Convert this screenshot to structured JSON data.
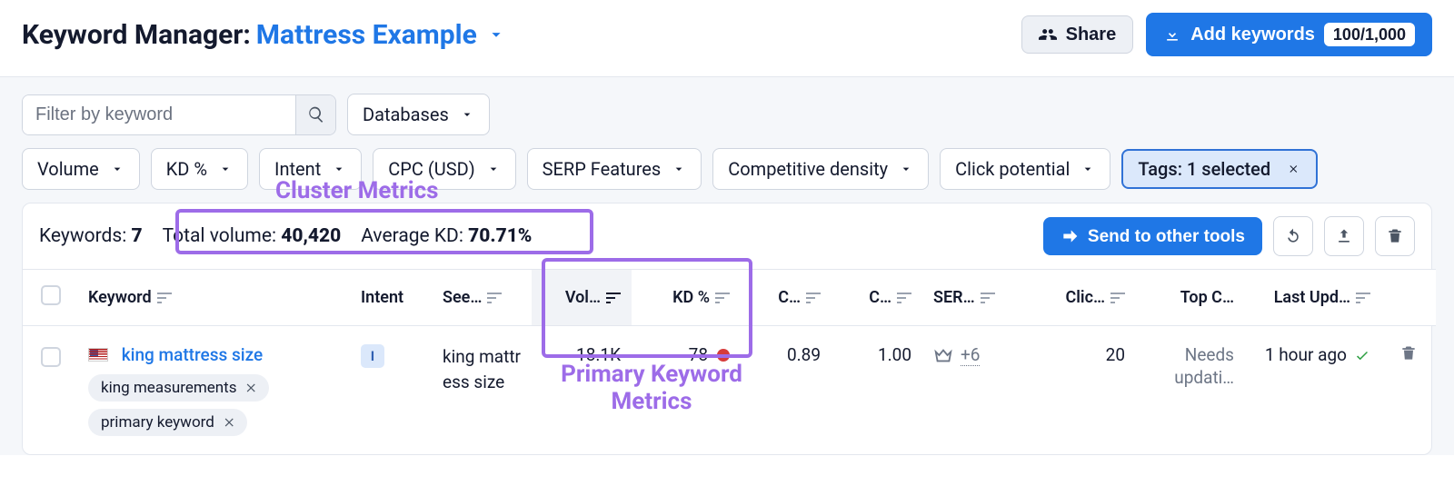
{
  "header": {
    "title_prefix": "Keyword Manager:",
    "project_name": "Mattress Example",
    "share_label": "Share",
    "add_label": "Add keywords",
    "add_count": "100/1,000"
  },
  "filters": {
    "search_placeholder": "Filter by keyword",
    "databases_label": "Databases",
    "items": [
      {
        "label": "Volume"
      },
      {
        "label": "KD %"
      },
      {
        "label": "Intent"
      },
      {
        "label": "CPC (USD)"
      },
      {
        "label": "SERP Features"
      },
      {
        "label": "Competitive density"
      },
      {
        "label": "Click potential"
      }
    ],
    "tags_label": "Tags: 1 selected"
  },
  "summary": {
    "keywords_label": "Keywords:",
    "keywords_value": "7",
    "total_volume_label": "Total volume:",
    "total_volume_value": "40,420",
    "avg_kd_label": "Average KD:",
    "avg_kd_value": "70.71%",
    "send_label": "Send to other tools"
  },
  "columns": {
    "keyword": "Keyword",
    "intent": "Intent",
    "seed": "See…",
    "vol": "Vol…",
    "kd": "KD %",
    "cpc": "C…",
    "cd": "C…",
    "serp": "SER…",
    "click": "Clic…",
    "topc": "Top C…",
    "lu": "Last Upd…"
  },
  "rows": [
    {
      "keyword": "king mattress size",
      "tags": [
        "king measurements",
        "primary keyword"
      ],
      "intent": "I",
      "seed": "king mattress size",
      "vol": "18.1K",
      "kd": "78",
      "cpc": "0.89",
      "cd": "1.00",
      "serp_more": "+6",
      "click": "20",
      "topc": "Needs updati…",
      "lu": "1 hour ago"
    }
  ],
  "annotations": {
    "cluster": "Cluster Metrics",
    "primary": "Primary Keyword Metrics"
  }
}
